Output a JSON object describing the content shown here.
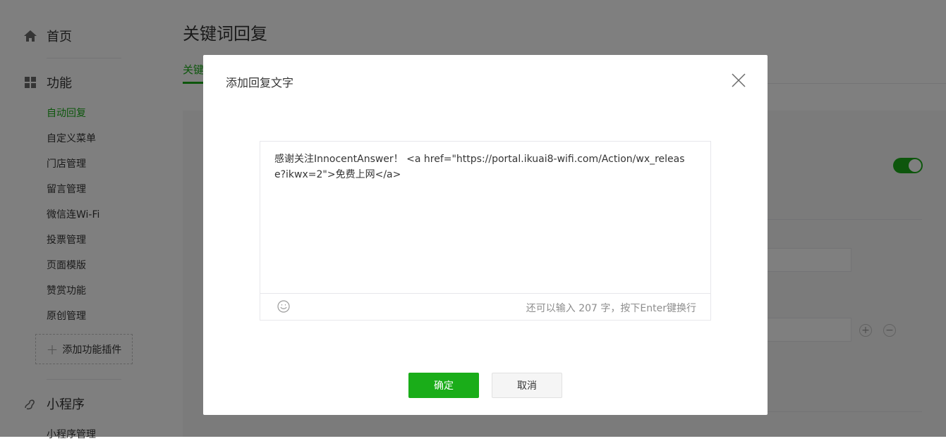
{
  "sidebar": {
    "home_label": "首页",
    "features_label": "功能",
    "sub_items": [
      {
        "label": "自动回复",
        "active": true
      },
      {
        "label": "自定义菜单",
        "active": false
      },
      {
        "label": "门店管理",
        "active": false
      },
      {
        "label": "留言管理",
        "active": false
      },
      {
        "label": "微信连Wi-Fi",
        "active": false
      },
      {
        "label": "投票管理",
        "active": false
      },
      {
        "label": "页面模版",
        "active": false
      },
      {
        "label": "赞赏功能",
        "active": false
      },
      {
        "label": "原创管理",
        "active": false
      }
    ],
    "add_plugin_label": "添加功能插件",
    "miniprogram_label": "小程序",
    "miniprogram_sub": "小程序管理"
  },
  "main": {
    "page_title": "关键词回复",
    "active_tab": "关键"
  },
  "dialog": {
    "title": "添加回复文字",
    "content": "感谢关注InnocentAnswer！ <a href=\"https://portal.ikuai8-wifi.com/Action/wx_release?ikwx=2\">免费上网</a>",
    "tip": "还可以输入 207 字，按下Enter键换行",
    "confirm_label": "确定",
    "cancel_label": "取消"
  },
  "colors": {
    "accent": "#1aad19",
    "overlay": "rgba(0,0,0,0.5)"
  },
  "icons": [
    "home-icon",
    "grid-icon",
    "plus-icon",
    "miniprogram-icon",
    "close-icon",
    "emoji-icon"
  ]
}
